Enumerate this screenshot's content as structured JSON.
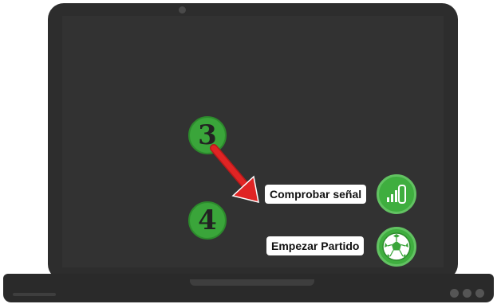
{
  "steps": [
    {
      "number": "3",
      "color": "#3aa53a"
    },
    {
      "number": "4",
      "color": "#3aa53a"
    }
  ],
  "actions": {
    "check_signal": {
      "label": "Comprobar señal",
      "icon": "signal-strength-icon"
    },
    "start_match": {
      "label": "Empezar Partido",
      "icon": "soccer-ball-icon"
    }
  },
  "colors": {
    "accent": "#3fae3f",
    "arrow": "#e02424",
    "screen": "#323232"
  }
}
